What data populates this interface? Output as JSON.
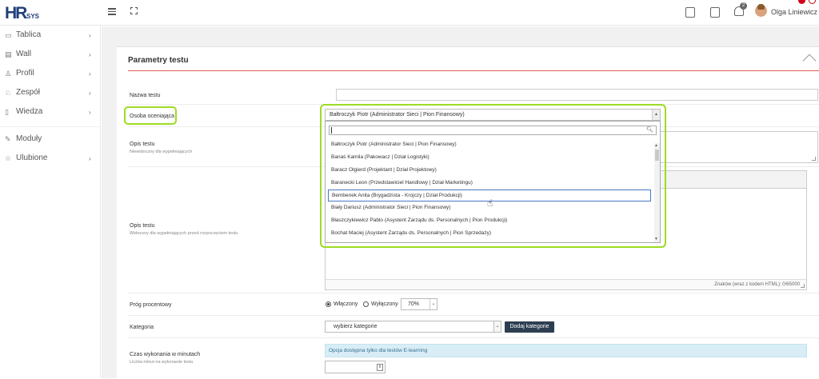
{
  "header": {
    "logo_hr": "HR",
    "logo_sys": "SYS",
    "notification_count": "2",
    "user_name": "Olga Liniewicz"
  },
  "sidebar": {
    "items": [
      {
        "label": "Tablica",
        "icon": "monitor-icon",
        "chevron": "›"
      },
      {
        "label": "Wall",
        "icon": "chat-icon",
        "chevron": "›"
      },
      {
        "label": "Profil",
        "icon": "user-icon",
        "chevron": "›"
      },
      {
        "label": "Zespół",
        "icon": "team-icon",
        "chevron": "›"
      },
      {
        "label": "Wiedza",
        "icon": "book-icon",
        "chevron": "›"
      },
      {
        "label": "Moduły",
        "icon": "wrench-icon",
        "chevron": ""
      },
      {
        "label": "Ulubione",
        "icon": "star-icon",
        "chevron": "›"
      }
    ]
  },
  "panel": {
    "title": "Parametry testu"
  },
  "form": {
    "name_label": "Nazwa testu",
    "assessor_label": "Osoba oceniająca",
    "assessor_selected": "Bałtroczyk Piotr (Administrator Sieci | Pion Finansowy)",
    "desc_label": "Opis testu",
    "desc_sub": "Niewidoczny dla wypełniających",
    "desc2_label": "Opis testu",
    "desc2_sub": "Widoczny dla wypełniających przed rozpoczęciem testu",
    "char_count": "Znaków (wraz z kodem HTML): 0/65000",
    "threshold_label": "Próg procentowy",
    "threshold_on": "Włączony",
    "threshold_off": "Wyłączony",
    "threshold_value": "70%",
    "category_label": "Kategoria",
    "category_placeholder": "wybierz kategorie",
    "add_category": "Dodaj kategorie",
    "time_label": "Czas wykonania w minutach",
    "time_sub": "Liczba minut na wykonanie testu",
    "time_info": "Opcja dostępna tylko dla testów E-learning"
  },
  "dropdown": {
    "options": [
      "Bałtroczyk Piotr (Administrator Sieci | Pion Finansowy)",
      "Banaś Kamila (Pakowacz | Dział Logistyki)",
      "Baracz Olgierd (Projektant | Dział Projektowy)",
      "Baranecki Leon (Przedstawiciel Handlowy | Dział Marketingu)",
      "Bembenek Anita (Brygadzista - Krojczy | Dział Produkcji)",
      "Biały Dariusz (Administrator Sieci | Pion Finansowy)",
      "Błaszczykiewicz Pablo (Asystent Zarządu ds. Personalnych | Pion Produkcji)",
      "Bochat Maciej (Asystent Zarządu ds. Personalnych | Pion Sprzedaży)"
    ]
  }
}
